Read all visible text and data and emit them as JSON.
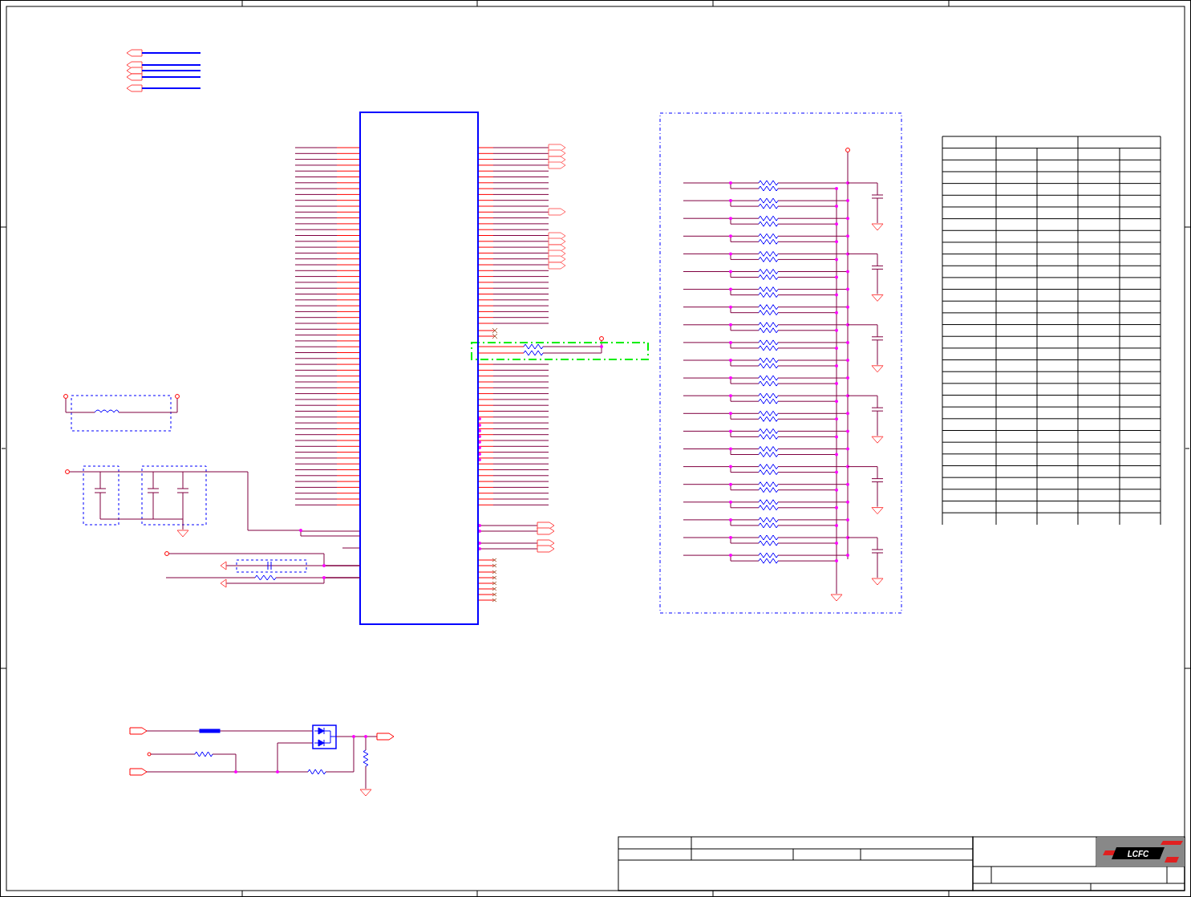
{
  "title_block": {
    "logo_text": "LCFC"
  }
}
